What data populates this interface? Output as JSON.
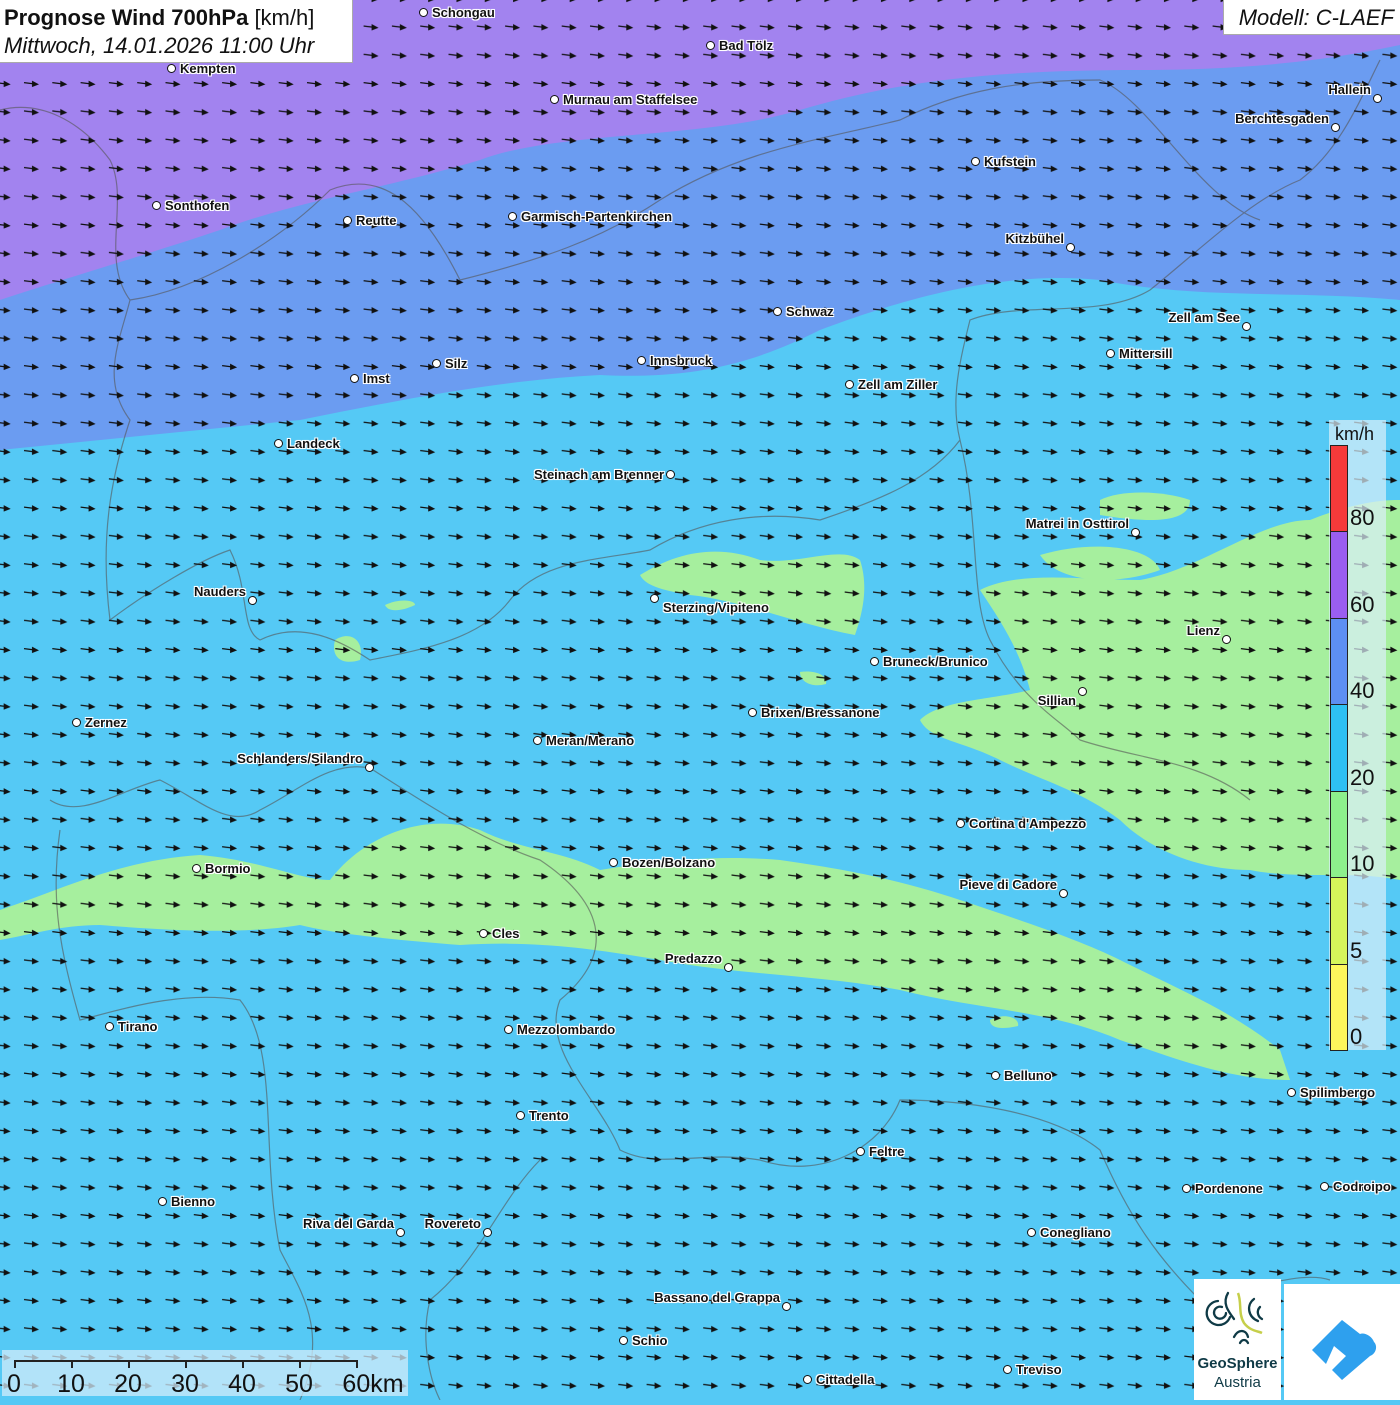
{
  "header": {
    "title_bold": "Prognose Wind 700hPa",
    "title_unit": "[km/h]",
    "datetime": "Mittwoch, 14.01.2026 11:00 Uhr",
    "model": "Modell: C-LAEF"
  },
  "legend": {
    "unit": "km/h",
    "bins": [
      {
        "label": "0",
        "color": "#fdf65c"
      },
      {
        "label": "5",
        "color": "#d6f55a"
      },
      {
        "label": "10",
        "color": "#8df08c"
      },
      {
        "label": "20",
        "color": "#2ec0f2"
      },
      {
        "label": "40",
        "color": "#5d8ff2"
      },
      {
        "label": "60",
        "color": "#9a5ef0"
      },
      {
        "label": "80",
        "color": "#f53a3a"
      }
    ]
  },
  "scale": {
    "ticks": [
      "0",
      "10",
      "20",
      "30",
      "40",
      "50",
      "60km"
    ]
  },
  "colors": {
    "purple": "#a283ef",
    "blue": "#6b9cf1",
    "cyan": "#55c9f5",
    "green": "#a6ef9e"
  },
  "cities": [
    "Schongau",
    "Bad Tölz",
    "Kempten",
    "Murnau am Staffelsee",
    "Hallein",
    "Berchtesgaden",
    "Kufstein",
    "Sonthofen",
    "Reutte",
    "Garmisch-Partenkirchen",
    "Kitzbühel",
    "Schwaz",
    "Zell am See",
    "Mittersill",
    "Innsbruck",
    "Silz",
    "Imst",
    "Zell am Ziller",
    "Landeck",
    "Steinach am Brenner",
    "Matrei in Osttirol",
    "Sterzing/Vipiteno",
    "Nauders",
    "Lienz",
    "Bruneck/Brunico",
    "Sillian",
    "Brixen/Bressanone",
    "Zernez",
    "Meran/Merano",
    "Schlanders/Silandro",
    "Cortina d'Ampezzo",
    "Bozen/Bolzano",
    "Bormio",
    "Pieve di Cadore",
    "Cles",
    "Predazzo",
    "Tirano",
    "Mezzolombardo",
    "Belluno",
    "Spilimbergo",
    "Trento",
    "Feltre",
    "Pordenone",
    "Codroipo",
    "Bienno",
    "Riva del Garda",
    "Rovereto",
    "Conegliano",
    "Bassano del Grappa",
    "Schio",
    "Treviso",
    "Cittadella"
  ],
  "logos": {
    "geosphere_line1": "GeoSphere",
    "geosphere_line2": "Austria"
  }
}
